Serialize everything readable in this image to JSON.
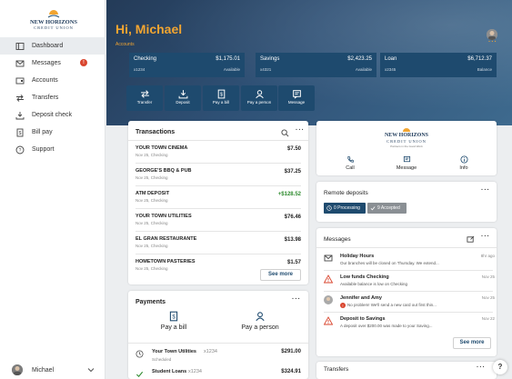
{
  "brand": {
    "name_line1": "NEW HORIZONS",
    "name_line2": "CREDIT UNION"
  },
  "sidebar": {
    "items": [
      {
        "label": "Dashboard",
        "icon": "dashboard-icon"
      },
      {
        "label": "Messages",
        "icon": "mail-icon",
        "badge": "!"
      },
      {
        "label": "Accounts",
        "icon": "accounts-icon"
      },
      {
        "label": "Transfers",
        "icon": "transfer-icon"
      },
      {
        "label": "Deposit check",
        "icon": "deposit-icon"
      },
      {
        "label": "Bill pay",
        "icon": "bill-icon"
      },
      {
        "label": "Support",
        "icon": "help-icon"
      }
    ],
    "user_name": "Michael"
  },
  "hero": {
    "greeting": "Hi, Michael",
    "accounts_label": "Accounts",
    "accounts": [
      {
        "name": "Checking",
        "amount": "$1,175.01",
        "number": "x1234",
        "balance_label": "Available"
      },
      {
        "name": "Savings",
        "amount": "$2,423.25",
        "number": "x4321",
        "balance_label": "Available"
      },
      {
        "name": "Loan",
        "amount": "$6,712.37",
        "number": "x2345",
        "balance_label": "Balance"
      }
    ],
    "actions": [
      "Transfer",
      "Deposit",
      "Pay a bill",
      "Pay a person",
      "Message"
    ]
  },
  "transactions": {
    "title": "Transactions",
    "rows": [
      {
        "name": "YOUR TOWN CINEMA",
        "date": "Nov 25, Checking",
        "amount": "$7.50"
      },
      {
        "name": "GEORGE'S BBQ & PUB",
        "date": "Nov 25, Checking",
        "amount": "$37.25"
      },
      {
        "name": "ATM DEPOSIT",
        "date": "Nov 25, Checking",
        "amount": "+$128.52"
      },
      {
        "name": "YOUR TOWN UTILITIES",
        "date": "Nov 25, Checking",
        "amount": "$76.46"
      },
      {
        "name": "EL GRAN RESTAURANTE",
        "date": "Nov 25, Checking",
        "amount": "$13.98"
      },
      {
        "name": "HOMETOWN PASTERIES",
        "date": "Nov 25, Checking",
        "amount": "$1.57"
      }
    ],
    "see_more": "See more"
  },
  "payments": {
    "title": "Payments",
    "pay_bill": "Pay a bill",
    "pay_person": "Pay a person",
    "rows": [
      {
        "name": "Your Town Utilities",
        "acct": "x1234",
        "status": "Scheduled",
        "amount": "$291.00"
      },
      {
        "name": "Student Loans",
        "acct": "x1234",
        "status": "",
        "amount": "$324.91"
      }
    ]
  },
  "contact": {
    "tagline": "Partners in the Good Work",
    "call": "Call",
    "message": "Message",
    "info": "Info"
  },
  "remote": {
    "title": "Remote deposits",
    "processing": "0 Processing",
    "accepted": "9 Accepted"
  },
  "messages": {
    "title": "Messages",
    "rows": [
      {
        "title": "Holiday Hours",
        "preview": "Our branches will be closed on Thursday. We extend...",
        "date": "8hr ago",
        "icon": "mail-icon"
      },
      {
        "title": "Low funds Checking",
        "preview": "Available balance is low on Checking",
        "date": "Nov 25",
        "icon": "warning-icon"
      },
      {
        "title": "Jennifer and Amy",
        "preview": "No problem! We'll send a new card out first thin...",
        "date": "Nov 25",
        "icon": "avatar-icon"
      },
      {
        "title": "Deposit to Savings",
        "preview": "A deposit over $200.00 was made to your Saving...",
        "date": "Nov 22",
        "icon": "warning-icon"
      }
    ],
    "see_more": "See more"
  },
  "transfers": {
    "title": "Transfers"
  },
  "colors": {
    "accent": "#f2a531",
    "navy": "#1e4a6e",
    "positive": "#2e8b2e",
    "warning": "#d9452e"
  }
}
